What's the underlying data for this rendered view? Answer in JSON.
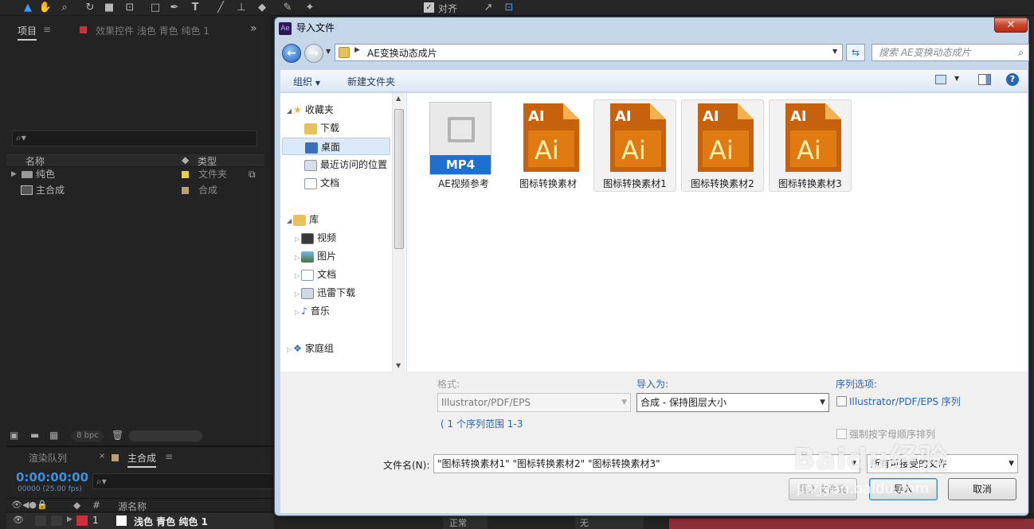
{
  "toolbar": {
    "align_label": "对齐"
  },
  "project_panel": {
    "tab_label": "项目",
    "effects_tab": "效果控件 浅色 青色 纯色 1",
    "columns": {
      "name": "名称",
      "type": "类型"
    },
    "items": [
      {
        "name": "纯色",
        "type": "文件夹",
        "color": "#e6d24a"
      },
      {
        "name": "主合成",
        "type": "合成",
        "color": "#b8a074"
      }
    ],
    "bpc": "8 bpc"
  },
  "timeline": {
    "render_tab": "渲染队列",
    "comp_tab": "主合成",
    "timecode": "0:00:00:00",
    "fps": "00000 (25.00 fps)",
    "column_hash": "#",
    "column_source": "源名称",
    "layer_num": "1",
    "layer_name": "浅色 青色 纯色 1",
    "mode": "正常",
    "trkmat": "无"
  },
  "dialog": {
    "title": "导入文件",
    "close_glyph": "✕",
    "address": "AE变换动态成片",
    "search_placeholder": "搜索 AE变换动态成片",
    "organize": "组织",
    "new_folder": "新建文件夹",
    "nav": {
      "favorites": "收藏夹",
      "download": "下载",
      "desktop": "桌面",
      "recent": "最近访问的位置",
      "documents": "文档",
      "library": "库",
      "videos": "视频",
      "pictures": "图片",
      "lib_docs": "文档",
      "thunder": "迅雷下载",
      "music": "音乐",
      "homegroup": "家庭组"
    },
    "files": [
      {
        "name": "AE视频参考",
        "kind": "MP4",
        "selected": false
      },
      {
        "name": "图标转换素材",
        "kind": "AI",
        "selected": false
      },
      {
        "name": "图标转换素材1",
        "kind": "AI",
        "selected": true
      },
      {
        "name": "图标转换素材2",
        "kind": "AI",
        "selected": true
      },
      {
        "name": "图标转换素材3",
        "kind": "AI",
        "selected": true
      }
    ],
    "format_label": "格式:",
    "format_value": "Illustrator/PDF/EPS",
    "sequence_range": "( 1 个序列范围 1-3",
    "import_as_label": "导入为:",
    "import_as_value": "合成 - 保持图层大小",
    "sequence_label": "序列选项:",
    "sequence_opt": "Illustrator/PDF/EPS 序列",
    "force_alpha": "强制按字母顺序排列",
    "filename_label": "文件名(N):",
    "filename_value": "\"图标转换素材1\" \"图标转换素材2\" \"图标转换素材3\"",
    "filetype_value": "所有可接受的文件",
    "import_folder": "导入文件夹",
    "import": "导入",
    "cancel": "取消"
  },
  "watermark": {
    "brand": "Baidu经验",
    "url": "jingyan.baidu.com"
  }
}
